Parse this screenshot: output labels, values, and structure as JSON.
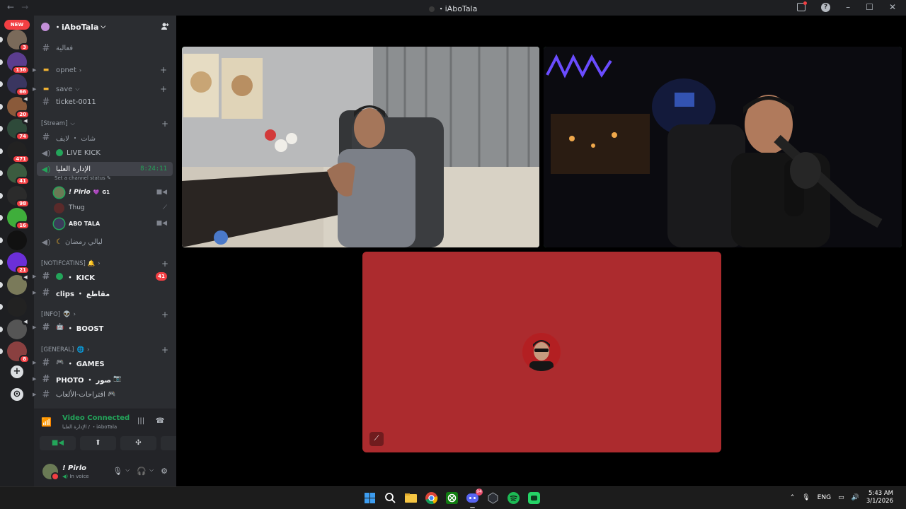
{
  "window": {
    "title": "・iAboTala",
    "nav_back": "←",
    "nav_forward": "→"
  },
  "rail": {
    "new_label": "NEW",
    "servers": [
      {
        "name": "server-1",
        "badge": "3",
        "color": "#7a6a5a"
      },
      {
        "name": "server-2",
        "badge": "136",
        "color": "#5b3d8f"
      },
      {
        "name": "server-3",
        "badge": "66",
        "color": "#3a3660"
      },
      {
        "name": "server-4",
        "badge": "20",
        "color": "#8a5a3a"
      },
      {
        "name": "server-5",
        "badge": "74",
        "color": "#2e4a3a"
      },
      {
        "name": "server-vexo",
        "badge": "471",
        "color": "#222222"
      },
      {
        "name": "server-7",
        "badge": "41",
        "color": "#3b5b3f"
      },
      {
        "name": "server-8",
        "badge": "98",
        "color": "#2b2b2b"
      },
      {
        "name": "server-9",
        "badge": "16",
        "color": "#3fae3b"
      },
      {
        "name": "server-r",
        "badge": "",
        "color": "#111111"
      },
      {
        "name": "server-twitch",
        "badge": "21",
        "color": "#6b2fd8"
      },
      {
        "name": "server-12",
        "badge": "",
        "color": "#7a7a5a"
      },
      {
        "name": "server-13",
        "badge": "",
        "color": "#222222"
      },
      {
        "name": "server-14",
        "badge": "",
        "color": "#555555"
      },
      {
        "name": "server-15",
        "badge": "8",
        "color": "#8a4040"
      }
    ],
    "add_label": "+",
    "discover_label": "⊙"
  },
  "guild": {
    "name": "・iAboTala",
    "chevron": "⌵",
    "add_user_icon": "add-user"
  },
  "channels": {
    "c1": "فعالية",
    "c2_folder": "opnet",
    "c3_folder": "save",
    "c4": "ticket-0011",
    "cat_stream": "[Stream]",
    "c5": "شات ・ لايف",
    "c6": "LIVE KICK",
    "c7": "الإدارة العليا",
    "c7_timer": "8:24:11",
    "c7_status": "Set a channel status",
    "voice_users": [
      {
        "name": "! Pirlo",
        "tag": "G1"
      },
      {
        "name": "Thug",
        "tag": ""
      },
      {
        "name": "ABO TALA",
        "tag": ""
      }
    ],
    "c8": "ليالي رمضان",
    "cat_notif": "[NOTIFCATINS] 🔔",
    "c9": "・ KICK",
    "c9_mentions": "41",
    "c10": "clips ・ مقاطع",
    "cat_info": "[INFO]",
    "c11": "・ BOOST",
    "cat_general": "[GENERAL]",
    "c12": "・ GAMES",
    "c13": "PHOTO ・ صور",
    "c14": "اقتراحات-الألعاب"
  },
  "voice_panel": {
    "title": "Video Connected",
    "subtitle": "الإدارة العليا / ・iAboTala"
  },
  "user": {
    "name": "! Pirlo",
    "status": "In voice"
  },
  "taskbar": {
    "discord_count": "94",
    "lang": "ENG",
    "time": "5:43 AM",
    "date": "3/1/2026"
  },
  "colors": {
    "speaking_ring": "#3ba55d",
    "tile3_bg": "#ac2b2e",
    "mention": "#f23f43",
    "online": "#23a55a"
  }
}
